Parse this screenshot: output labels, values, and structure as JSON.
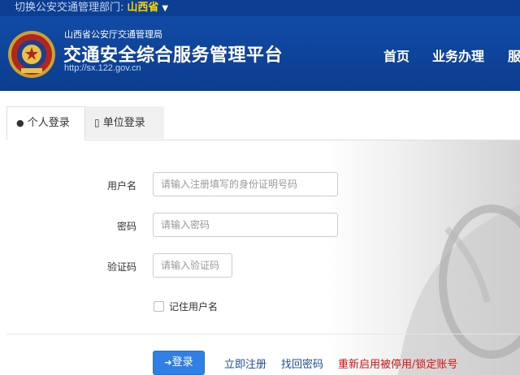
{
  "topbar": {
    "switch_label": "切换公安交通管理部门:",
    "province": "山西省",
    "caret": "▼"
  },
  "header": {
    "org": "山西省公安厅交通管理局",
    "platform": "交通安全综合服务管理平台",
    "url": "http://sx.122.gov.cn",
    "nav": [
      "首页",
      "业务办理",
      "服"
    ]
  },
  "tabs": [
    {
      "label": "个人登录",
      "icon": "user-icon",
      "active": true
    },
    {
      "label": "单位登录",
      "icon": "document-icon",
      "active": false
    }
  ],
  "form": {
    "username_label": "用户名",
    "username_placeholder": "请输入注册填写的身份证明号码",
    "password_label": "密码",
    "password_placeholder": "请输入密码",
    "captcha_label": "验证码",
    "captcha_placeholder": "请输入验证码",
    "remember_label": "记住用户名",
    "remember_checked": false
  },
  "actions": {
    "login_label": "登录",
    "register_label": "立即注册",
    "recover_label": "找回密码",
    "reactivate_label": "重新启用被停用/锁定账号"
  },
  "colors": {
    "header_blue": "#0b3f93",
    "province_yellow": "#ffd400",
    "button_blue": "#2f7fe5",
    "link_blue": "#1a4fa5",
    "warning_red": "#dd1111"
  }
}
